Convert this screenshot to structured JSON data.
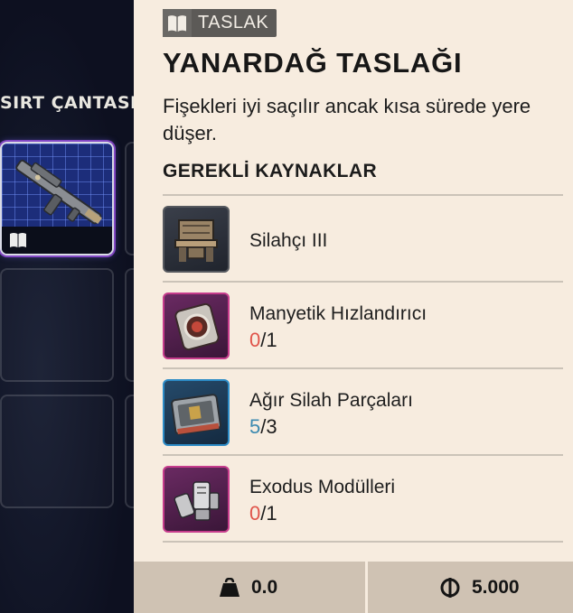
{
  "backpack": {
    "title": "SIRT ÇANTASI",
    "slots": [
      {
        "state": "selected",
        "item_icon": "rifle-icon",
        "badge_icon": "blueprint-book-icon"
      },
      {
        "state": "empty"
      },
      {
        "state": "empty"
      },
      {
        "state": "empty"
      },
      {
        "state": "empty"
      },
      {
        "state": "empty"
      }
    ]
  },
  "panel": {
    "tag_icon": "blueprint-book-icon",
    "tag_label": "TASLAK",
    "title": "YANARDAĞ TASLAĞI",
    "description": "Fişekleri iyi saçılır ancak kısa sürede yere düşer.",
    "requirements_title": "GEREKLİ KAYNAKLAR",
    "resources": [
      {
        "name": "Silahçı III",
        "icon": "workbench-icon",
        "rarity": "common"
      },
      {
        "name": "Manyetik Hızlandırıcı",
        "icon": "magnetic-accelerator-icon",
        "rarity": "epic",
        "have": "0",
        "need": "/1",
        "status": "insufficient"
      },
      {
        "name": "Ağır Silah Parçaları",
        "icon": "weapon-parts-case-icon",
        "rarity": "rare",
        "have": "5",
        "need": "/3",
        "status": "sufficient"
      },
      {
        "name": "Exodus Modülleri",
        "icon": "exodus-modules-icon",
        "rarity": "epic",
        "have": "0",
        "need": "/1",
        "status": "insufficient"
      }
    ]
  },
  "footer": {
    "weight_icon": "weight-icon",
    "weight": "0.0",
    "currency_icon": "coin-icon",
    "price": "5.000"
  },
  "colors": {
    "panel_bg": "#f7ecdf",
    "insufficient": "#e0544a",
    "sufficient": "#3c8ab0",
    "epic": "#c63c8c",
    "rare": "#2c8bc6"
  }
}
